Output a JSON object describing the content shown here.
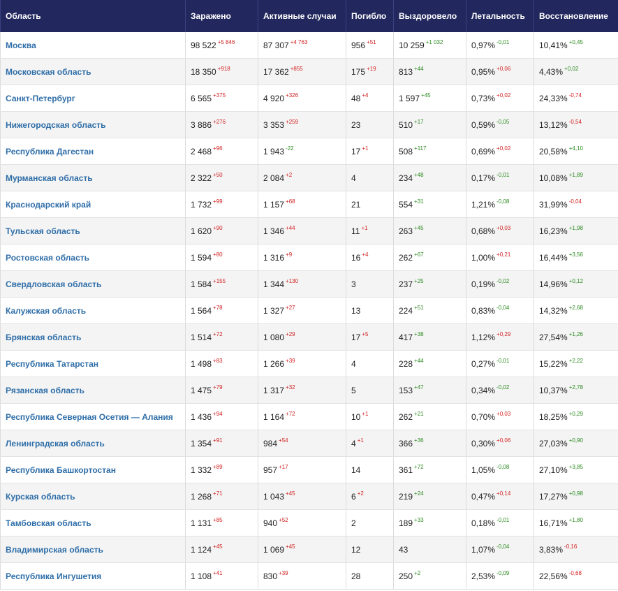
{
  "columns": [
    "Область",
    "Заражено",
    "Активные случаи",
    "Погибло",
    "Выздоровело",
    "Летальность",
    "Восстановление"
  ],
  "colors": {
    "header_bg": "#22285e",
    "region_link": "#2f6ea8",
    "delta_red": "#d32020",
    "delta_green": "#2b8a1f"
  },
  "rows": [
    {
      "region": "Москва",
      "infected": "98 522",
      "infected_d": "+5 846",
      "infected_t": "up",
      "active": "87 307",
      "active_d": "+4 763",
      "active_t": "up",
      "died": "956",
      "died_d": "+51",
      "died_t": "up",
      "recovered": "10 259",
      "recovered_d": "+1 032",
      "recovered_t": "down",
      "lethality": "0,97%",
      "lethality_d": "-0,01",
      "lethality_t": "down",
      "recovery": "10,41%",
      "recovery_d": "+0,45",
      "recovery_t": "down"
    },
    {
      "region": "Московская область",
      "infected": "18 350",
      "infected_d": "+918",
      "infected_t": "up",
      "active": "17 362",
      "active_d": "+855",
      "active_t": "up",
      "died": "175",
      "died_d": "+19",
      "died_t": "up",
      "recovered": "813",
      "recovered_d": "+44",
      "recovered_t": "down",
      "lethality": "0,95%",
      "lethality_d": "+0,06",
      "lethality_t": "up",
      "recovery": "4,43%",
      "recovery_d": "+0,02",
      "recovery_t": "down"
    },
    {
      "region": "Санкт-Петербург",
      "infected": "6 565",
      "infected_d": "+375",
      "infected_t": "up",
      "active": "4 920",
      "active_d": "+326",
      "active_t": "up",
      "died": "48",
      "died_d": "+4",
      "died_t": "up",
      "recovered": "1 597",
      "recovered_d": "+45",
      "recovered_t": "down",
      "lethality": "0,73%",
      "lethality_d": "+0,02",
      "lethality_t": "up",
      "recovery": "24,33%",
      "recovery_d": "-0,74",
      "recovery_t": "up"
    },
    {
      "region": "Нижегородская область",
      "infected": "3 886",
      "infected_d": "+276",
      "infected_t": "up",
      "active": "3 353",
      "active_d": "+259",
      "active_t": "up",
      "died": "23",
      "died_d": "",
      "died_t": "up",
      "recovered": "510",
      "recovered_d": "+17",
      "recovered_t": "down",
      "lethality": "0,59%",
      "lethality_d": "-0,05",
      "lethality_t": "down",
      "recovery": "13,12%",
      "recovery_d": "-0,54",
      "recovery_t": "up"
    },
    {
      "region": "Республика Дагестан",
      "infected": "2 468",
      "infected_d": "+96",
      "infected_t": "up",
      "active": "1 943",
      "active_d": "-22",
      "active_t": "down",
      "died": "17",
      "died_d": "+1",
      "died_t": "up",
      "recovered": "508",
      "recovered_d": "+117",
      "recovered_t": "down",
      "lethality": "0,69%",
      "lethality_d": "+0,02",
      "lethality_t": "up",
      "recovery": "20,58%",
      "recovery_d": "+4,10",
      "recovery_t": "down"
    },
    {
      "region": "Мурманская область",
      "infected": "2 322",
      "infected_d": "+50",
      "infected_t": "up",
      "active": "2 084",
      "active_d": "+2",
      "active_t": "up",
      "died": "4",
      "died_d": "",
      "died_t": "up",
      "recovered": "234",
      "recovered_d": "+48",
      "recovered_t": "down",
      "lethality": "0,17%",
      "lethality_d": "-0,01",
      "lethality_t": "down",
      "recovery": "10,08%",
      "recovery_d": "+1,89",
      "recovery_t": "down"
    },
    {
      "region": "Краснодарский край",
      "infected": "1 732",
      "infected_d": "+99",
      "infected_t": "up",
      "active": "1 157",
      "active_d": "+68",
      "active_t": "up",
      "died": "21",
      "died_d": "",
      "died_t": "up",
      "recovered": "554",
      "recovered_d": "+31",
      "recovered_t": "down",
      "lethality": "1,21%",
      "lethality_d": "-0,08",
      "lethality_t": "down",
      "recovery": "31,99%",
      "recovery_d": "-0,04",
      "recovery_t": "up"
    },
    {
      "region": "Тульская область",
      "infected": "1 620",
      "infected_d": "+90",
      "infected_t": "up",
      "active": "1 346",
      "active_d": "+44",
      "active_t": "up",
      "died": "11",
      "died_d": "+1",
      "died_t": "up",
      "recovered": "263",
      "recovered_d": "+45",
      "recovered_t": "down",
      "lethality": "0,68%",
      "lethality_d": "+0,03",
      "lethality_t": "up",
      "recovery": "16,23%",
      "recovery_d": "+1,98",
      "recovery_t": "down"
    },
    {
      "region": "Ростовская область",
      "infected": "1 594",
      "infected_d": "+80",
      "infected_t": "up",
      "active": "1 316",
      "active_d": "+9",
      "active_t": "up",
      "died": "16",
      "died_d": "+4",
      "died_t": "up",
      "recovered": "262",
      "recovered_d": "+67",
      "recovered_t": "down",
      "lethality": "1,00%",
      "lethality_d": "+0,21",
      "lethality_t": "up",
      "recovery": "16,44%",
      "recovery_d": "+3,56",
      "recovery_t": "down"
    },
    {
      "region": "Свердловская область",
      "infected": "1 584",
      "infected_d": "+155",
      "infected_t": "up",
      "active": "1 344",
      "active_d": "+130",
      "active_t": "up",
      "died": "3",
      "died_d": "",
      "died_t": "up",
      "recovered": "237",
      "recovered_d": "+25",
      "recovered_t": "down",
      "lethality": "0,19%",
      "lethality_d": "-0,02",
      "lethality_t": "down",
      "recovery": "14,96%",
      "recovery_d": "+0,12",
      "recovery_t": "down"
    },
    {
      "region": "Калужская область",
      "infected": "1 564",
      "infected_d": "+78",
      "infected_t": "up",
      "active": "1 327",
      "active_d": "+27",
      "active_t": "up",
      "died": "13",
      "died_d": "",
      "died_t": "up",
      "recovered": "224",
      "recovered_d": "+51",
      "recovered_t": "down",
      "lethality": "0,83%",
      "lethality_d": "-0,04",
      "lethality_t": "down",
      "recovery": "14,32%",
      "recovery_d": "+2,68",
      "recovery_t": "down"
    },
    {
      "region": "Брянская область",
      "infected": "1 514",
      "infected_d": "+72",
      "infected_t": "up",
      "active": "1 080",
      "active_d": "+29",
      "active_t": "up",
      "died": "17",
      "died_d": "+5",
      "died_t": "up",
      "recovered": "417",
      "recovered_d": "+38",
      "recovered_t": "down",
      "lethality": "1,12%",
      "lethality_d": "+0,29",
      "lethality_t": "up",
      "recovery": "27,54%",
      "recovery_d": "+1,26",
      "recovery_t": "down"
    },
    {
      "region": "Республика Татарстан",
      "infected": "1 498",
      "infected_d": "+83",
      "infected_t": "up",
      "active": "1 266",
      "active_d": "+39",
      "active_t": "up",
      "died": "4",
      "died_d": "",
      "died_t": "up",
      "recovered": "228",
      "recovered_d": "+44",
      "recovered_t": "down",
      "lethality": "0,27%",
      "lethality_d": "-0,01",
      "lethality_t": "down",
      "recovery": "15,22%",
      "recovery_d": "+2,22",
      "recovery_t": "down"
    },
    {
      "region": "Рязанская область",
      "infected": "1 475",
      "infected_d": "+79",
      "infected_t": "up",
      "active": "1 317",
      "active_d": "+32",
      "active_t": "up",
      "died": "5",
      "died_d": "",
      "died_t": "up",
      "recovered": "153",
      "recovered_d": "+47",
      "recovered_t": "down",
      "lethality": "0,34%",
      "lethality_d": "-0,02",
      "lethality_t": "down",
      "recovery": "10,37%",
      "recovery_d": "+2,78",
      "recovery_t": "down"
    },
    {
      "region": "Республика Северная Осетия — Алания",
      "infected": "1 436",
      "infected_d": "+94",
      "infected_t": "up",
      "active": "1 164",
      "active_d": "+72",
      "active_t": "up",
      "died": "10",
      "died_d": "+1",
      "died_t": "up",
      "recovered": "262",
      "recovered_d": "+21",
      "recovered_t": "down",
      "lethality": "0,70%",
      "lethality_d": "+0,03",
      "lethality_t": "up",
      "recovery": "18,25%",
      "recovery_d": "+0,29",
      "recovery_t": "down"
    },
    {
      "region": "Ленинградская область",
      "infected": "1 354",
      "infected_d": "+91",
      "infected_t": "up",
      "active": "984",
      "active_d": "+54",
      "active_t": "up",
      "died": "4",
      "died_d": "+1",
      "died_t": "up",
      "recovered": "366",
      "recovered_d": "+36",
      "recovered_t": "down",
      "lethality": "0,30%",
      "lethality_d": "+0,06",
      "lethality_t": "up",
      "recovery": "27,03%",
      "recovery_d": "+0,90",
      "recovery_t": "down"
    },
    {
      "region": "Республика Башкортостан",
      "infected": "1 332",
      "infected_d": "+89",
      "infected_t": "up",
      "active": "957",
      "active_d": "+17",
      "active_t": "up",
      "died": "14",
      "died_d": "",
      "died_t": "up",
      "recovered": "361",
      "recovered_d": "+72",
      "recovered_t": "down",
      "lethality": "1,05%",
      "lethality_d": "-0,08",
      "lethality_t": "down",
      "recovery": "27,10%",
      "recovery_d": "+3,85",
      "recovery_t": "down"
    },
    {
      "region": "Курская область",
      "infected": "1 268",
      "infected_d": "+71",
      "infected_t": "up",
      "active": "1 043",
      "active_d": "+45",
      "active_t": "up",
      "died": "6",
      "died_d": "+2",
      "died_t": "up",
      "recovered": "219",
      "recovered_d": "+24",
      "recovered_t": "down",
      "lethality": "0,47%",
      "lethality_d": "+0,14",
      "lethality_t": "up",
      "recovery": "17,27%",
      "recovery_d": "+0,98",
      "recovery_t": "down"
    },
    {
      "region": "Тамбовская область",
      "infected": "1 131",
      "infected_d": "+85",
      "infected_t": "up",
      "active": "940",
      "active_d": "+52",
      "active_t": "up",
      "died": "2",
      "died_d": "",
      "died_t": "up",
      "recovered": "189",
      "recovered_d": "+33",
      "recovered_t": "down",
      "lethality": "0,18%",
      "lethality_d": "-0,01",
      "lethality_t": "down",
      "recovery": "16,71%",
      "recovery_d": "+1,80",
      "recovery_t": "down"
    },
    {
      "region": "Владимирская область",
      "infected": "1 124",
      "infected_d": "+45",
      "infected_t": "up",
      "active": "1 069",
      "active_d": "+45",
      "active_t": "up",
      "died": "12",
      "died_d": "",
      "died_t": "up",
      "recovered": "43",
      "recovered_d": "",
      "recovered_t": "down",
      "lethality": "1,07%",
      "lethality_d": "-0,04",
      "lethality_t": "down",
      "recovery": "3,83%",
      "recovery_d": "-0,16",
      "recovery_t": "up"
    },
    {
      "region": "Республика Ингушетия",
      "infected": "1 108",
      "infected_d": "+41",
      "infected_t": "up",
      "active": "830",
      "active_d": "+39",
      "active_t": "up",
      "died": "28",
      "died_d": "",
      "died_t": "up",
      "recovered": "250",
      "recovered_d": "+2",
      "recovered_t": "down",
      "lethality": "2,53%",
      "lethality_d": "-0,09",
      "lethality_t": "down",
      "recovery": "22,56%",
      "recovery_d": "-0,68",
      "recovery_t": "up"
    }
  ]
}
